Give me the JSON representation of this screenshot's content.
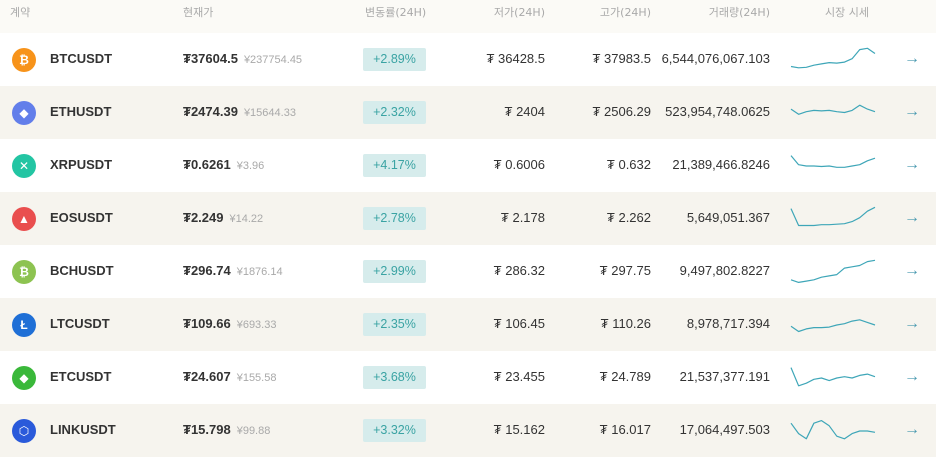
{
  "header": {
    "pair": "계약",
    "price": "현재가",
    "change": "변동률(24H)",
    "low": "저가(24H)",
    "high": "고가(24H)",
    "volume": "거래량(24H)",
    "market": "시장 시세"
  },
  "colors": {
    "change_bg": "#d6ecec",
    "change_text": "#3aa3a3",
    "sparkline": "#3ea6b8",
    "arrow": "#4a9ab0"
  },
  "rows": [
    {
      "icon": "bitcoin-icon",
      "color": "#f7931a",
      "glyph": "₿",
      "symbol": "BTCUSDT",
      "price": "₮37604.5",
      "cny": "¥237754.45",
      "change": "+2.89%",
      "low": "₮ 36428.5",
      "high": "₮ 37983.5",
      "volume": "6,544,076,067.103",
      "spark": [
        0.75,
        0.8,
        0.78,
        0.7,
        0.65,
        0.6,
        0.62,
        0.58,
        0.45,
        0.1,
        0.05,
        0.25
      ]
    },
    {
      "icon": "ethereum-icon",
      "color": "#627eea",
      "glyph": "◆",
      "symbol": "ETHUSDT",
      "price": "₮2474.39",
      "cny": "¥15644.33",
      "change": "+2.32%",
      "low": "₮ 2404",
      "high": "₮ 2506.29",
      "volume": "523,954,748.0625",
      "spark": [
        0.35,
        0.55,
        0.45,
        0.4,
        0.42,
        0.4,
        0.45,
        0.48,
        0.4,
        0.2,
        0.35,
        0.45
      ]
    },
    {
      "icon": "xrp-icon",
      "color": "#23c5a3",
      "glyph": "✕",
      "symbol": "XRPUSDT",
      "price": "₮0.6261",
      "cny": "¥3.96",
      "change": "+4.17%",
      "low": "₮ 0.6006",
      "high": "₮ 0.632",
      "volume": "21,389,466.8246",
      "spark": [
        0.1,
        0.45,
        0.5,
        0.5,
        0.52,
        0.5,
        0.55,
        0.55,
        0.5,
        0.45,
        0.3,
        0.2
      ]
    },
    {
      "icon": "eos-icon",
      "color": "#e94e4e",
      "glyph": "▲",
      "symbol": "EOSUSDT",
      "price": "₮2.249",
      "cny": "¥14.22",
      "change": "+2.78%",
      "low": "₮ 2.178",
      "high": "₮ 2.262",
      "volume": "5,649,051.367",
      "spark": [
        0.1,
        0.75,
        0.75,
        0.75,
        0.72,
        0.72,
        0.7,
        0.68,
        0.6,
        0.45,
        0.2,
        0.05
      ]
    },
    {
      "icon": "bitcoin-cash-icon",
      "color": "#8dc351",
      "glyph": "₿",
      "symbol": "BCHUSDT",
      "price": "₮296.74",
      "cny": "¥1876.14",
      "change": "+2.99%",
      "low": "₮ 286.32",
      "high": "₮ 297.75",
      "volume": "9,497,802.8227",
      "spark": [
        0.8,
        0.9,
        0.85,
        0.8,
        0.7,
        0.65,
        0.6,
        0.35,
        0.3,
        0.25,
        0.1,
        0.05
      ]
    },
    {
      "icon": "litecoin-icon",
      "color": "#1f6fd6",
      "glyph": "Ł",
      "symbol": "LTCUSDT",
      "price": "₮109.66",
      "cny": "¥693.33",
      "change": "+2.35%",
      "low": "₮ 106.45",
      "high": "₮ 110.26",
      "volume": "8,978,717.394",
      "spark": [
        0.55,
        0.75,
        0.65,
        0.6,
        0.6,
        0.58,
        0.5,
        0.45,
        0.35,
        0.3,
        0.4,
        0.5
      ]
    },
    {
      "icon": "ethereum-classic-icon",
      "color": "#3ab83a",
      "glyph": "◆",
      "symbol": "ETCUSDT",
      "price": "₮24.607",
      "cny": "¥155.58",
      "change": "+3.68%",
      "low": "₮ 23.455",
      "high": "₮ 24.789",
      "volume": "21,537,377.191",
      "spark": [
        0.1,
        0.8,
        0.7,
        0.55,
        0.5,
        0.6,
        0.5,
        0.45,
        0.5,
        0.4,
        0.35,
        0.45
      ]
    },
    {
      "icon": "chainlink-icon",
      "color": "#2a5ada",
      "glyph": "⬡",
      "symbol": "LINKUSDT",
      "price": "₮15.798",
      "cny": "¥99.88",
      "change": "+3.32%",
      "low": "₮ 15.162",
      "high": "₮ 16.017",
      "volume": "17,064,497.503",
      "spark": [
        0.2,
        0.6,
        0.8,
        0.2,
        0.1,
        0.3,
        0.7,
        0.8,
        0.6,
        0.5,
        0.5,
        0.55
      ]
    }
  ]
}
